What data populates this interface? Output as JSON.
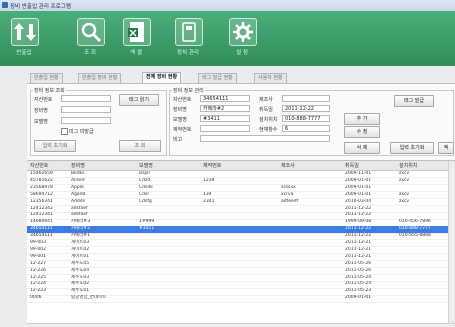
{
  "window": {
    "title": "장비 반출입 관리 프로그램"
  },
  "toolbar": {
    "buttons": [
      {
        "label": "반출입",
        "icon": "up-down-arrows-icon"
      },
      {
        "label": "조 회",
        "icon": "magnifier-icon"
      },
      {
        "label": "엑 셀",
        "icon": "excel-icon"
      },
      {
        "label": "장치 관리",
        "icon": "device-icon"
      },
      {
        "label": "설 정",
        "icon": "gear-icon"
      }
    ]
  },
  "tabs": [
    "반출입 현황",
    "반출입 장비 현황",
    "전체 장비 현황",
    "태그 발급 현황",
    "사용자 현황"
  ],
  "active_tab": "전체 장비 현황",
  "search_panel": {
    "title": "장비 정보 조회",
    "asset_label": "자산번호",
    "name_label": "장비명",
    "model_label": "모델명",
    "tag_read_button": "태그 읽기",
    "checkbox_label": "미그 미발급",
    "init_button": "입력 초기화",
    "query_button": "조 회"
  },
  "manage_panel": {
    "title": "장비 정보 관리",
    "asset_label": "자산번호",
    "asset_value": "34654111",
    "name_label": "장비명",
    "name_value": "카메라#2",
    "model_label": "모델명",
    "model_value": "#3411",
    "serial_label": "제작번호",
    "serial_value": "",
    "note_label": "비고",
    "maker_label": "제조사",
    "maker_value": "",
    "date_label": "취득일",
    "date_value": "2011-12-22",
    "place_label": "설치위치",
    "place_value": "010-888-7777",
    "count_label": "현재창수",
    "count_value": "6",
    "tag_issue_button": "태그 발급",
    "add_button": "추 가",
    "edit_button": "수 정",
    "delete_button": "삭 제",
    "init_button": "입력 초기화",
    "excel_button": "엑"
  },
  "grid": {
    "columns": [
      "자산번호",
      "장비명",
      "모델명",
      "제작번호",
      "제조사",
      "취득일",
      "설치위치"
    ],
    "rows": [
      [
        "15462659",
        "Bkdks",
        "Dsjill",
        "",
        "",
        "2009-11-01",
        "zxcv"
      ],
      [
        "45785622",
        "Allsed",
        "Cdzd",
        "1234",
        "",
        "2009-01-01",
        "zxcv"
      ],
      [
        "23568978",
        "Apple",
        "Cdsdk",
        "",
        "ssssxx",
        "2009-01-01",
        ""
      ],
      [
        "58694712",
        "Agadd",
        "Cdsl",
        "134",
        "xcrva",
        "2009-01-01",
        "zxcv"
      ],
      [
        "12356241",
        "Addds",
        "Cdsfg",
        "2341",
        "adfeedf",
        "2010-03-04",
        "zxcv"
      ],
      [
        "12412342",
        "adsfaef",
        "",
        "",
        "",
        "2011-12-22",
        ""
      ],
      [
        "12412341",
        "adsfaef",
        "",
        "",
        "",
        "2011-12-22",
        ""
      ],
      [
        "14684641",
        "카메라#3",
        "1#999",
        "",
        "",
        "1999-09-08",
        "010-456-7896"
      ],
      [
        "34654111",
        "카메라#2",
        "#3411",
        "",
        "",
        "2011-12-22",
        "010-888-7777"
      ],
      [
        "34654111",
        "카메라#1",
        "",
        "",
        "",
        "2011-12-22",
        "010-555-8888"
      ],
      [
        "99-003",
        "게이트03",
        "",
        "",
        "",
        "2011-12-21",
        ""
      ],
      [
        "99-002",
        "게이트02",
        "",
        "",
        "",
        "2011-12-21",
        ""
      ],
      [
        "99-001",
        "게이트01",
        "",
        "",
        "",
        "2011-12-21",
        ""
      ],
      [
        "12-227",
        "제주도05",
        "",
        "",
        "",
        "2011-05-26",
        ""
      ],
      [
        "12-226",
        "제주도04",
        "",
        "",
        "",
        "2011-05-26",
        ""
      ],
      [
        "12-225",
        "제주도03",
        "",
        "",
        "",
        "2011-05-24",
        ""
      ],
      [
        "12-224",
        "제주도02",
        "",
        "",
        "",
        "2011-05-24",
        ""
      ],
      [
        "12-223",
        "제주도01",
        "",
        "",
        "",
        "2011-05-23",
        ""
      ],
      [
        "0006",
        "탐공영상_면데이트",
        "",
        "",
        "",
        "2009-01-01",
        ""
      ]
    ],
    "selected_row": 8
  }
}
